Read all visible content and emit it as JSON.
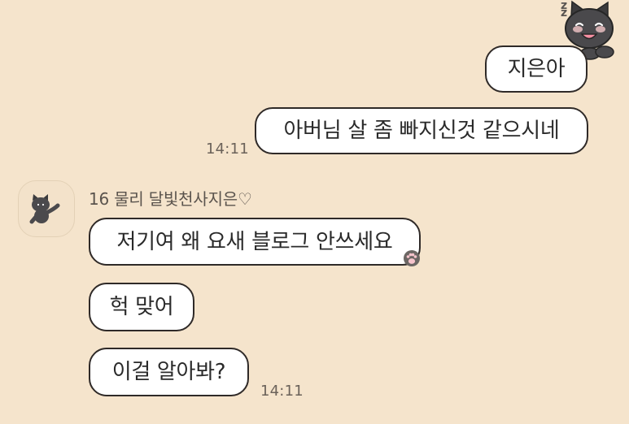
{
  "chat": {
    "outgoing": [
      {
        "text": "지은아"
      },
      {
        "text": "아버님 살 좀 빠지신것 같으시네"
      }
    ],
    "outgoing_time": "14:11",
    "incoming": {
      "sender": "16 물리 달빛천사지은♡",
      "messages": [
        {
          "text": "저기여 왜 요새 블로그 안쓰세요"
        },
        {
          "text": "헉 맞어"
        },
        {
          "text": "이걸 알아봐?"
        }
      ],
      "time": "14:11"
    }
  },
  "sticker": {
    "zz_text": "z\nz"
  },
  "colors": {
    "background": "#f5e4cc",
    "bubble": "#ffffff",
    "bubble_border": "#2f2a28",
    "timestamp": "#6b625a",
    "name": "#5a534d"
  },
  "icons": {
    "top_sticker": "sleeping-cat-sticker-icon",
    "avatar": "gray-cat-avatar-icon",
    "paw": "paw-icon"
  }
}
